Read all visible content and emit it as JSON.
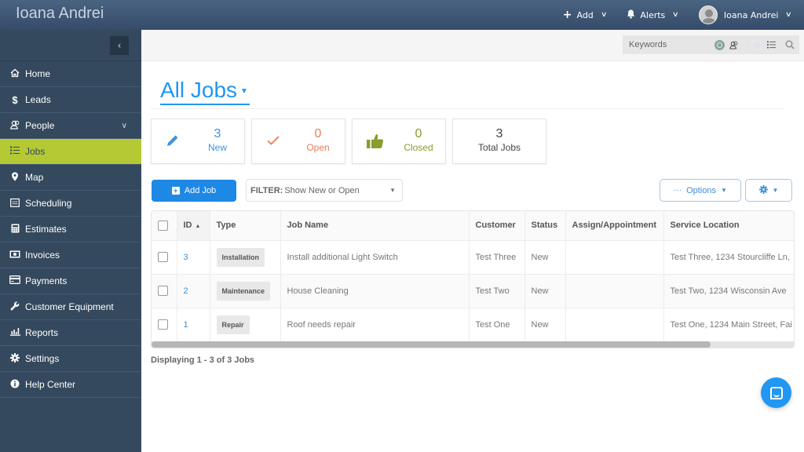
{
  "topbar": {
    "brand": "Ioana Andrei",
    "add_label": "Add",
    "alerts_label": "Alerts",
    "user_name": "Ioana Andrei"
  },
  "sidebar": {
    "collapse_icon": "chevron-left-icon",
    "items": [
      {
        "label": "Home",
        "icon": "home-icon"
      },
      {
        "label": "Leads",
        "icon": "dollar-icon"
      },
      {
        "label": "People",
        "icon": "people-icon",
        "expandable": true
      },
      {
        "label": "Jobs",
        "icon": "list-icon",
        "active": true
      },
      {
        "label": "Map",
        "icon": "map-pin-icon"
      },
      {
        "label": "Scheduling",
        "icon": "calendar-icon"
      },
      {
        "label": "Estimates",
        "icon": "calculator-icon"
      },
      {
        "label": "Invoices",
        "icon": "money-icon"
      },
      {
        "label": "Payments",
        "icon": "credit-card-icon"
      },
      {
        "label": "Customer Equipment",
        "icon": "wrench-icon"
      },
      {
        "label": "Reports",
        "icon": "bar-chart-icon"
      },
      {
        "label": "Settings",
        "icon": "gear-icon"
      },
      {
        "label": "Help Center",
        "icon": "info-icon"
      }
    ],
    "active_color": "#b5c934"
  },
  "search": {
    "placeholder": "Keywords",
    "mode_people_selected": true,
    "mode_list_selected": false
  },
  "page": {
    "title": "All Jobs"
  },
  "stats": [
    {
      "value": "3",
      "label": "New",
      "icon": "pencil-icon",
      "color": "#3d94dc"
    },
    {
      "value": "0",
      "label": "Open",
      "icon": "check-icon",
      "color": "#ec7a5b"
    },
    {
      "value": "0",
      "label": "Closed",
      "icon": "thumbs-up-icon",
      "color": "#8a9d2d"
    },
    {
      "value": "3",
      "label": "Total Jobs",
      "color": "#444444"
    }
  ],
  "toolbar": {
    "add_job_label": "Add Job",
    "filter_prefix": "FILTER:",
    "filter_value": "Show New or Open",
    "options_label": "Options"
  },
  "table": {
    "columns": [
      "ID",
      "Type",
      "Job Name",
      "Customer",
      "Status",
      "Assign/Appointment",
      "Service Location"
    ],
    "sort": {
      "column": "ID",
      "direction": "asc"
    },
    "rows": [
      {
        "id": "3",
        "type": "Installation",
        "job_name": "Install additional Light Switch",
        "customer": "Test Three",
        "status": "New",
        "assign": "",
        "location": "Test Three, 1234 Stourcliffe Ln,"
      },
      {
        "id": "2",
        "type": "Maintenance",
        "job_name": "House Cleaning",
        "customer": "Test Two",
        "status": "New",
        "assign": "",
        "location": "Test Two, 1234 Wisconsin Ave"
      },
      {
        "id": "1",
        "type": "Repair",
        "job_name": "Roof needs repair",
        "customer": "Test One",
        "status": "New",
        "assign": "",
        "location": "Test One, 1234 Main Street, Fai"
      }
    ],
    "footer": "Displaying 1 - 3 of 3 Jobs"
  },
  "colors": {
    "topbar": "#3d5470",
    "sidebar": "#34495e",
    "primary": "#1e88e5"
  }
}
